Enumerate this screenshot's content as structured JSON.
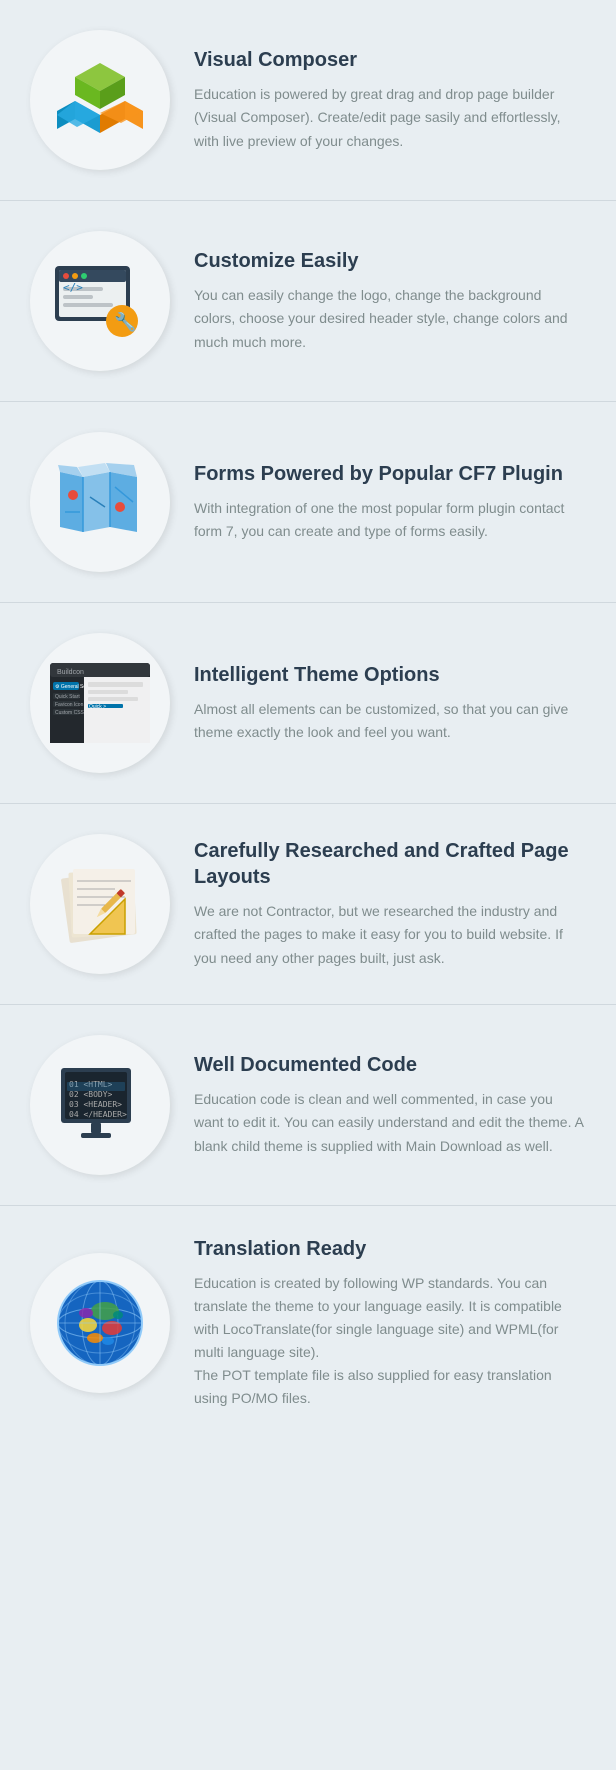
{
  "features": [
    {
      "id": "visual-composer",
      "title": "Visual Composer",
      "description": "Education is powered by great drag and drop page builder (Visual Composer). Create/edit page sasily and effortlessly, with live preview of your changes.",
      "icon": "visual-composer-icon"
    },
    {
      "id": "customize",
      "title": "Customize Easily",
      "description": "You can easily change the logo, change the background colors, choose your desired header style, change colors and much much more.",
      "icon": "customize-icon"
    },
    {
      "id": "cf7",
      "title": "Forms Powered by Popular CF7 Plugin",
      "description": "With integration of one the most popular form plugin contact form 7, you can create and type of forms easily.",
      "icon": "cf7-icon"
    },
    {
      "id": "theme-options",
      "title": "Intelligent Theme Options",
      "description": "Almost all elements can be customized, so that you can give theme exactly the look and feel you want.",
      "icon": "theme-options-icon"
    },
    {
      "id": "page-layouts",
      "title": "Carefully Researched and Crafted Page Layouts",
      "description": "We are not Contractor, but we researched the industry and crafted the pages to make it easy for you to build website. If you need any other pages built, just ask.",
      "icon": "page-layouts-icon"
    },
    {
      "id": "well-documented",
      "title": "Well Documented Code",
      "description": "Education code is clean and well com­mented, in case you want to edit it. You can easily understand and edit the theme. A blank child theme is supplied with Main Download as well.",
      "icon": "code-icon"
    },
    {
      "id": "translation",
      "title": "Translation Ready",
      "description": "Education is created by following WP standards. You can translate the theme to your language easily. It is compatible with LocoTranslate(for single language site) and WPML(for multi language site).\nThe POT template file is also supplied for easy translation using PO/MO files.",
      "icon": "translation-icon"
    }
  ]
}
